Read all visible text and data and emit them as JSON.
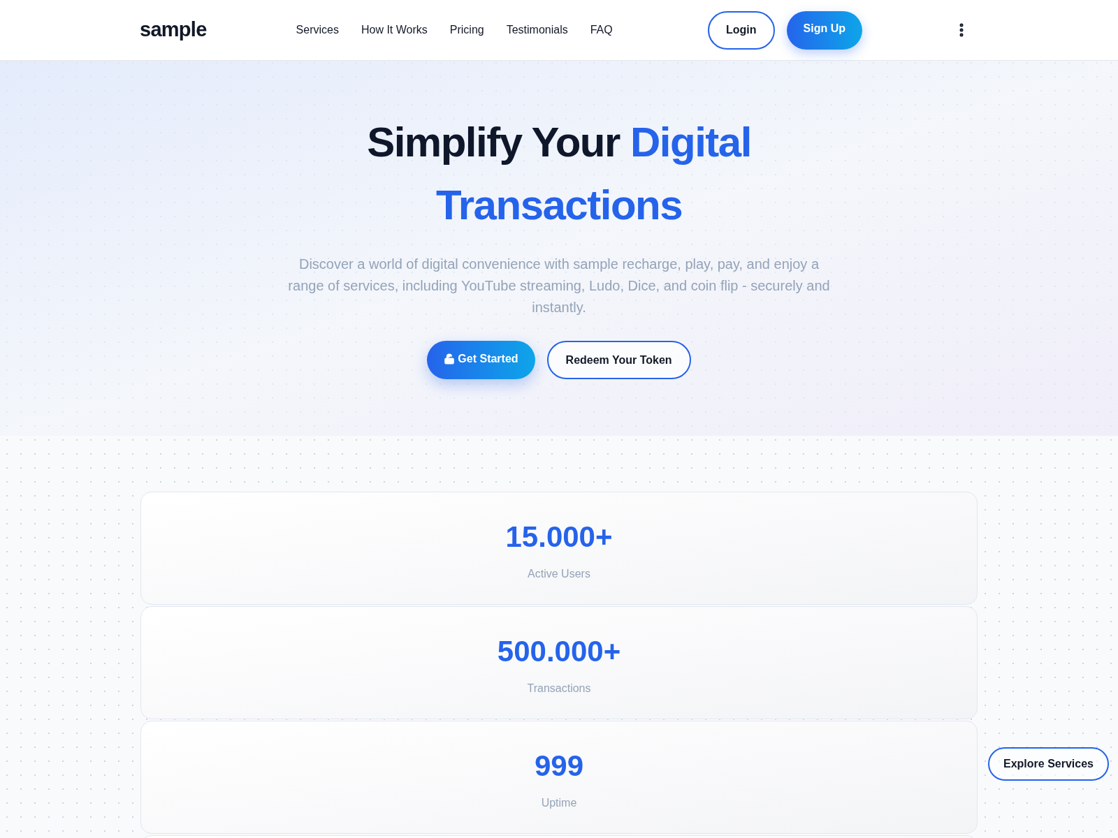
{
  "header": {
    "logo": "sample",
    "nav": [
      "Services",
      "How It Works",
      "Pricing",
      "Testimonials",
      "FAQ"
    ],
    "login": "Login",
    "signup": "Sign Up"
  },
  "hero": {
    "title": [
      {
        "text": "Simplify Your",
        "highlighted": false
      },
      {
        "text": "Digital Transactions",
        "highlighted": true
      }
    ],
    "description": "Discover a world of digital convenience with sample recharge, play, pay, and enjoy a range of services, including YouTube streaming, Ludo, Dice, and coin flip - securely and instantly.",
    "primary_button": "Get Started",
    "secondary_button": "Redeem Your Token"
  },
  "stats": [
    {
      "value": "15.000+",
      "label": "Active Users"
    },
    {
      "value": "500.000+",
      "label": "Transactions"
    },
    {
      "value": "999",
      "label": "Uptime"
    }
  ],
  "floating_button": "Explore Services"
}
